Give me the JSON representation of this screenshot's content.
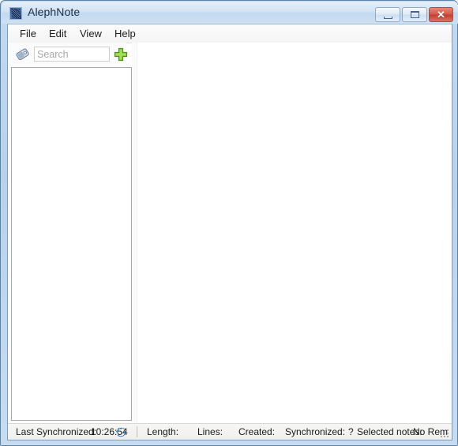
{
  "window": {
    "title": "AlephNote",
    "app_icon": "app-logo-icon",
    "controls": {
      "minimize": "minimize-icon",
      "maximize": "maximize-icon",
      "close": "✕",
      "close_label": "Close"
    }
  },
  "menubar": {
    "items": [
      {
        "label": "File"
      },
      {
        "label": "Edit"
      },
      {
        "label": "View"
      },
      {
        "label": "Help"
      }
    ]
  },
  "left_panel": {
    "tag_icon": "tag-icon",
    "search": {
      "value": "",
      "placeholder": "Search"
    },
    "add_button": {
      "icon": "plus-icon",
      "label": "+"
    },
    "note_list": {
      "items": [],
      "empty_text": ""
    }
  },
  "editor": {
    "content": ""
  },
  "statusbar": {
    "last_synchronized_label": "Last Synchronized:",
    "last_synchronized_value": "10:26:54",
    "sync_icon": "sync-refresh-icon",
    "length_label": "Length:",
    "length_value": "",
    "lines_label": "Lines:",
    "lines_value": "",
    "created_label": "Created:",
    "created_value": "",
    "synchronized_label": "Synchronized:",
    "synchronized_value": "?",
    "selected_notes_label": "Selected notes:",
    "selected_notes_value": "",
    "remote_text": "No Rem"
  },
  "colors": {
    "title_bar": "#cfe0f2",
    "frame": "#c3d9ef",
    "accent_green": "#7ac43a",
    "close_red": "#c23f31",
    "sync_blue": "#2f7fc4"
  }
}
